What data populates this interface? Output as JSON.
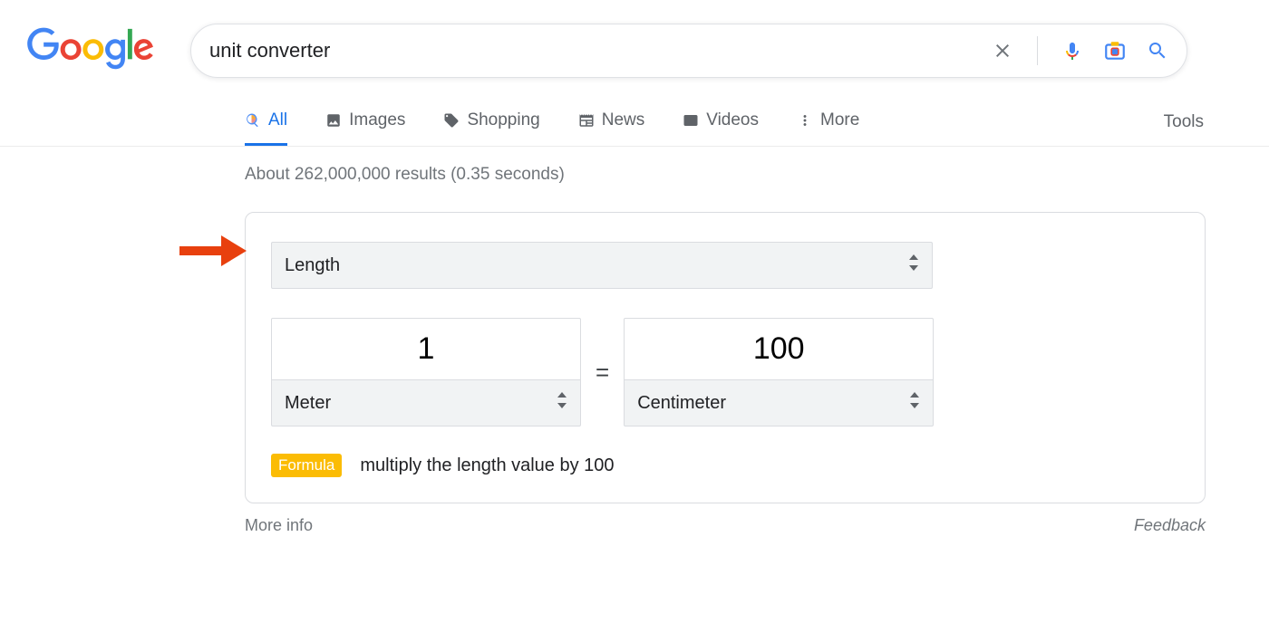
{
  "search": {
    "query": "unit converter"
  },
  "tabs": {
    "all": "All",
    "images": "Images",
    "shopping": "Shopping",
    "news": "News",
    "videos": "Videos",
    "more": "More",
    "tools": "Tools"
  },
  "results_stats": "About 262,000,000 results (0.35 seconds)",
  "converter": {
    "category": "Length",
    "from_value": "1",
    "to_value": "100",
    "from_unit": "Meter",
    "to_unit": "Centimeter",
    "formula_label": "Formula",
    "formula_text": "multiply the length value by 100"
  },
  "footer": {
    "more_info": "More info",
    "feedback": "Feedback"
  }
}
